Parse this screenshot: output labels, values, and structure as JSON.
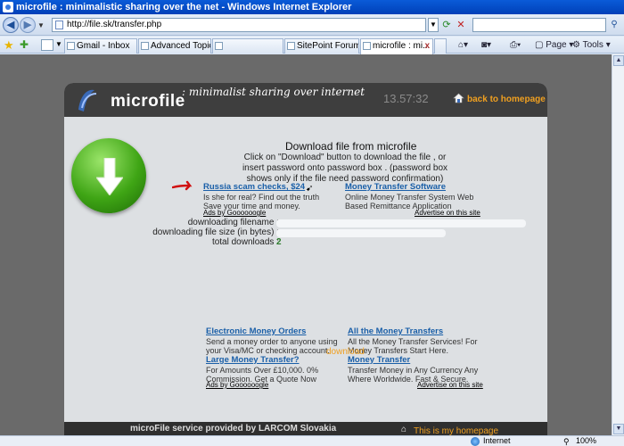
{
  "window": {
    "title": "microfile : minimalistic sharing over the net - Windows Internet Explorer"
  },
  "address_bar": {
    "url": "http://file.sk/transfer.php"
  },
  "tabs": [
    {
      "label": "Gmail - Inbox",
      "active": false
    },
    {
      "label": "Advanced Topics...",
      "active": false
    },
    {
      "label": "",
      "active": false
    },
    {
      "label": "SitePoint Forums...",
      "active": false
    },
    {
      "label": "microfile : mi...",
      "active": true
    }
  ],
  "toolbar": {
    "page_label": "Page",
    "tools_label": "Tools"
  },
  "site": {
    "logo_text": "microfile",
    "tagline": ": minimalist sharing over internet",
    "clock": "13.57:32",
    "back_home": "back to homepage",
    "title": "Download file from microfile",
    "instructions": "Click on \"Download\" button to download the file , or insert password onto password box . (password box shows only if the file need password confirmation)",
    "ads_top": [
      {
        "title": "Russia scam checks, $24",
        "body": "Is she for real? Find out the truth Save your time and money."
      },
      {
        "title": "Money Transfer Software",
        "body": "Online Money Transfer System Web Based Remittance Application"
      }
    ],
    "ads_by_top": "Ads by Goooooogle",
    "advertise_top": "Advertise on this site",
    "file_info": {
      "filename_label": "downloading filename :",
      "size_label": "downloading file size (in bytes) :",
      "total_label": "total downloads :",
      "total_value": "2"
    },
    "ads_bottom": [
      {
        "title": "Electronic Money Orders",
        "body": "Send a money order to anyone using your Visa/MC or checking account."
      },
      {
        "title": "All the Money Transfers",
        "body": "All the Money Transfer Services! For Money Transfers Start Here."
      },
      {
        "title": "Large Money Transfer?",
        "body": "For Amounts Over £10,000. 0% Commission. Get a Quote Now"
      },
      {
        "title": "Money Transfer",
        "body": "Transfer Money in Any Currency Any Where Worldwide. Fast & Secure."
      }
    ],
    "download_link": "download",
    "ads_by_bottom": "Ads by Goooooogle",
    "advertise_bottom": "Advertise on this site",
    "footer_text": "microFile service provided by LARCOM Slovakia",
    "footer_home": "This is my homepage"
  },
  "status_bar": {
    "zone": "Internet",
    "zoom": "100%"
  },
  "colors": {
    "accent_orange": "#f0a020",
    "link_blue": "#1a5fa8",
    "header_dark": "#3e3e3e"
  }
}
